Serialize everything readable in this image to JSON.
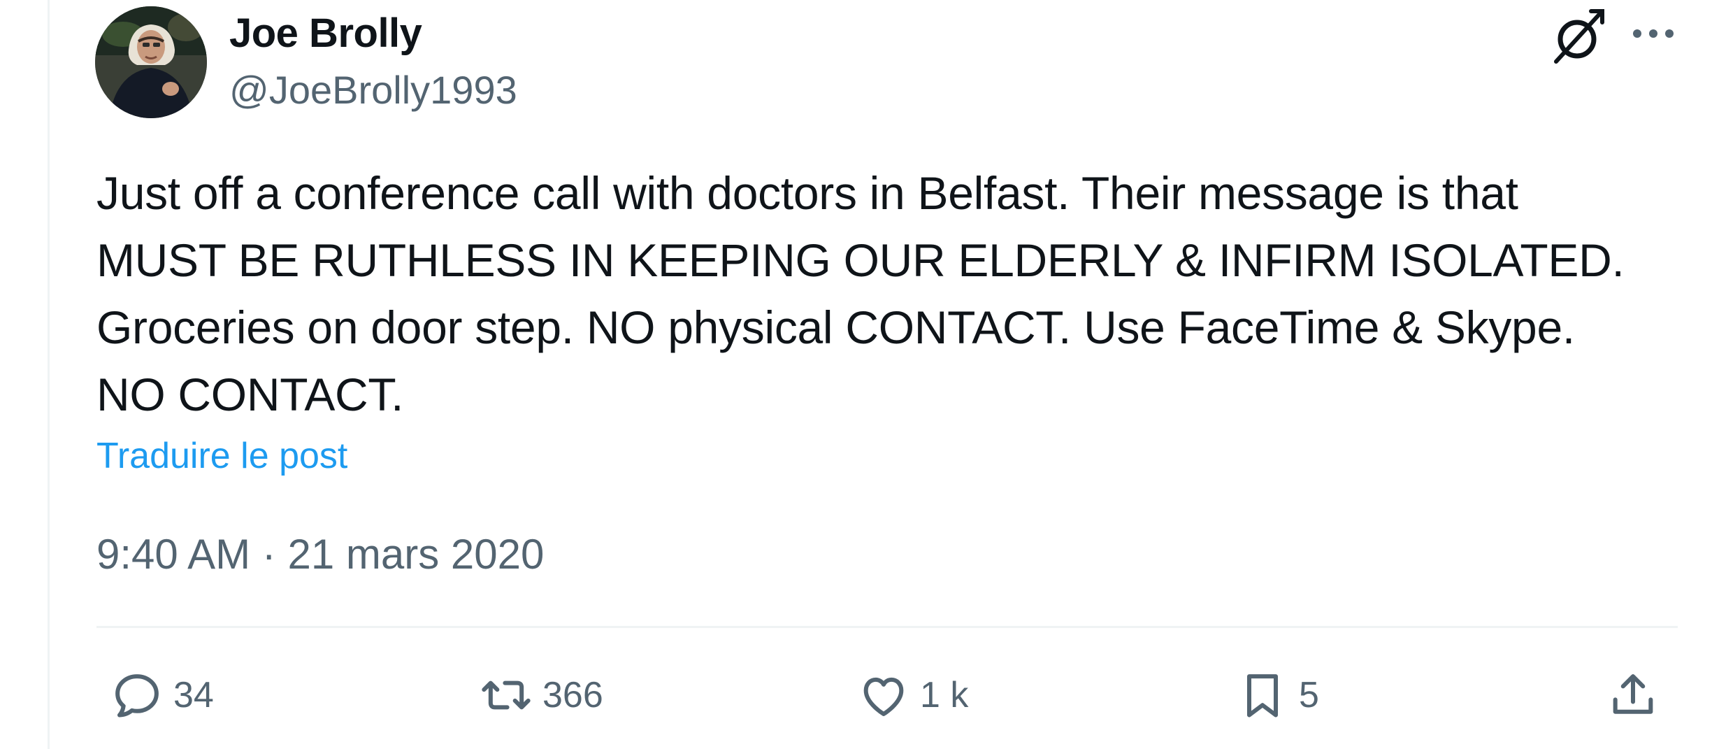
{
  "author": {
    "display_name": "Joe Brolly",
    "handle": "@JoeBrolly1993"
  },
  "tweet": {
    "lines": [
      "Just off a conference call with doctors in Belfast. Their message is that",
      "MUST BE RUTHLESS IN KEEPING OUR ELDERLY & INFIRM ISOLATED.",
      "Groceries on door step. NO physical CONTACT. Use FaceTime & Skype.",
      "NO CONTACT."
    ],
    "translate_label": "Traduire le post",
    "timestamp": "9:40 AM · 21 mars 2020"
  },
  "actions": {
    "reply_count": "34",
    "retweet_count": "366",
    "like_count": "1 k",
    "bookmark_count": "5"
  },
  "icons": {
    "grok": "grok-icon",
    "more": "more-dots-icon",
    "reply": "reply-bubble-icon",
    "retweet": "retweet-icon",
    "like": "heart-icon",
    "bookmark": "bookmark-icon",
    "share": "share-icon"
  },
  "colors": {
    "text": "#0f1419",
    "secondary": "#536471",
    "link": "#1d9bf0",
    "divider": "#eff3f4"
  }
}
